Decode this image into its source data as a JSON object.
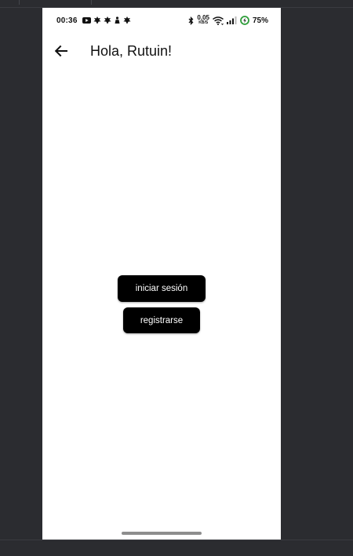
{
  "status_bar": {
    "time": "00:36",
    "left_icons": [
      "youtube-icon",
      "notification-icon",
      "notification-icon",
      "notification-icon",
      "notification-icon"
    ],
    "net_speed_value": "0,05",
    "net_speed_unit": "KB/S",
    "right_icons": [
      "bluetooth-icon",
      "wifi-icon",
      "signal-icon",
      "battery-icon"
    ],
    "battery_percent": "75%"
  },
  "app_bar": {
    "title": "Hola, Rutuin!",
    "back_icon": "arrow-left-icon"
  },
  "actions": {
    "login_label": "iniciar sesión",
    "register_label": "registrarse"
  },
  "colors": {
    "button_bg": "#000000",
    "button_text": "#ffffff",
    "battery_accent": "#2e9e3a",
    "host_background": "#2b2c30"
  }
}
